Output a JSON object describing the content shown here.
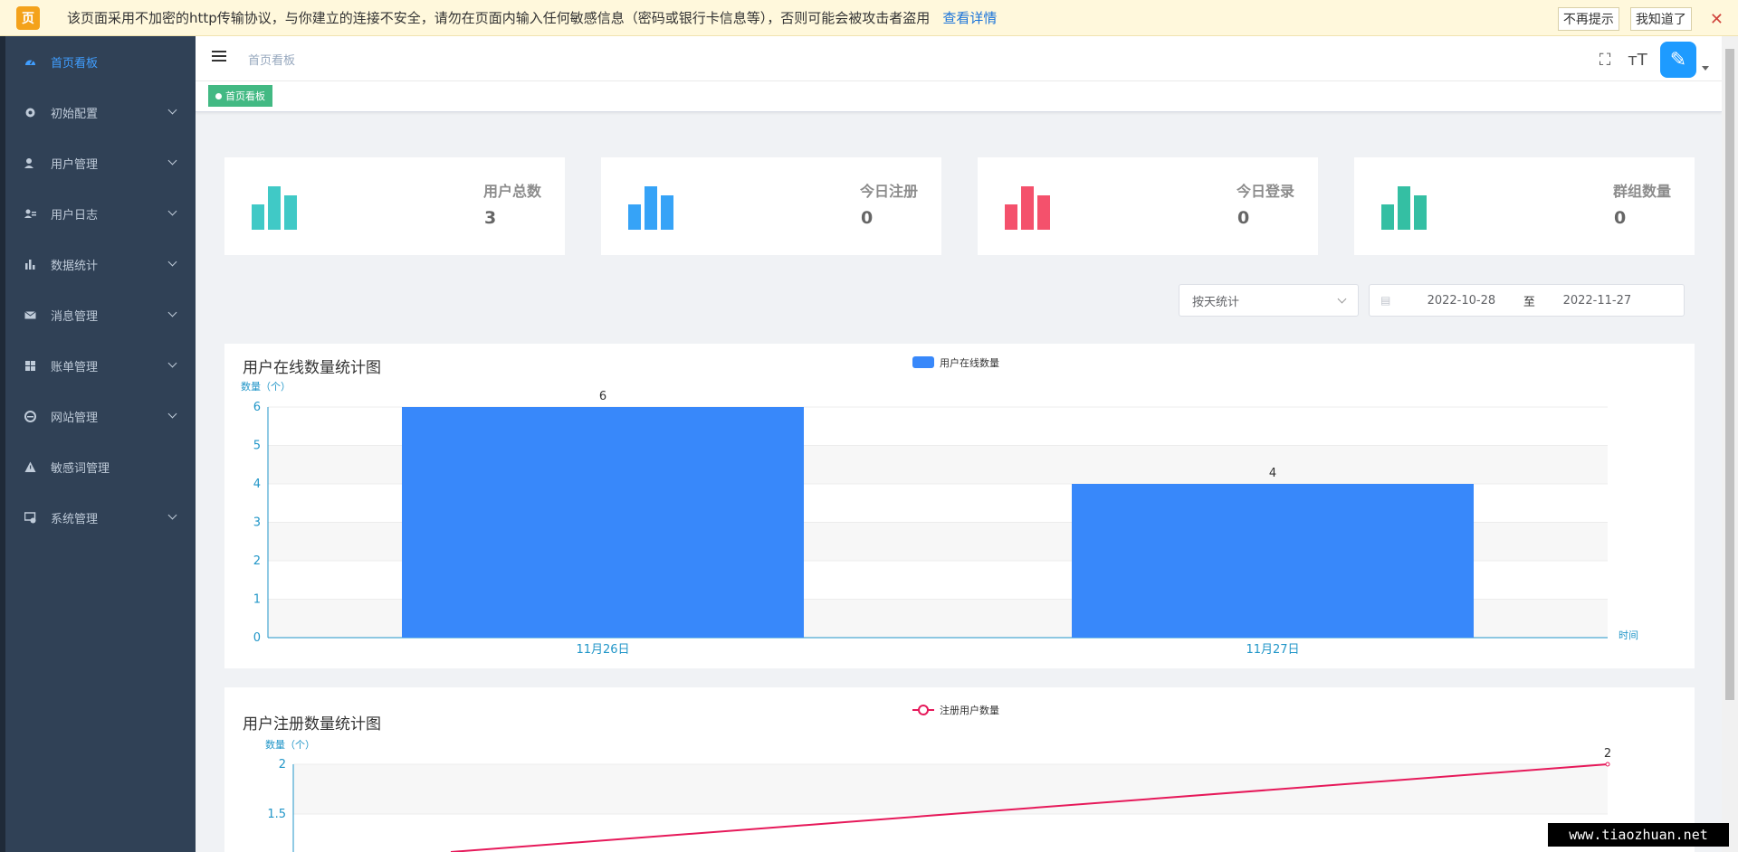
{
  "banner": {
    "logo": "页",
    "text": "该页面采用不加密的http传输协议，与你建立的连接不安全，请勿在页面内输入任何敏感信息（密码或银行卡信息等），否则可能会被攻击者盗用",
    "link": "查看详情",
    "no_remind": "不再提示",
    "got_it": "我知道了",
    "close": "✕"
  },
  "sidebar": {
    "items": [
      {
        "label": "首页看板",
        "icon": "dashboard-icon",
        "active": true
      },
      {
        "label": "初始配置",
        "icon": "settings-gear-icon",
        "expandable": true
      },
      {
        "label": "用户管理",
        "icon": "user-icon",
        "expandable": true
      },
      {
        "label": "用户日志",
        "icon": "user-log-icon",
        "expandable": true
      },
      {
        "label": "数据统计",
        "icon": "bar-chart-icon",
        "expandable": true
      },
      {
        "label": "消息管理",
        "icon": "mail-icon",
        "expandable": true
      },
      {
        "label": "账单管理",
        "icon": "grid-icon",
        "expandable": true
      },
      {
        "label": "网站管理",
        "icon": "browser-icon",
        "expandable": true
      },
      {
        "label": "敏感词管理",
        "icon": "warning-icon",
        "expandable": false
      },
      {
        "label": "系统管理",
        "icon": "system-icon",
        "expandable": true
      }
    ]
  },
  "navbar": {
    "breadcrumb": "首页看板",
    "fullscreen_icon": "⛶",
    "fontsize_icon": "тT",
    "avatar_glyph": "✎"
  },
  "tags": {
    "active": "首页看板"
  },
  "cards": [
    {
      "label": "用户总数",
      "value": "3",
      "color": "#40c9c6"
    },
    {
      "label": "今日注册",
      "value": "0",
      "color": "#36a3f7"
    },
    {
      "label": "今日登录",
      "value": "0",
      "color": "#f4516c"
    },
    {
      "label": "群组数量",
      "value": "0",
      "color": "#34bfa3"
    }
  ],
  "filters": {
    "mode": "按天统计",
    "start_date": "2022-10-28",
    "separator": "至",
    "end_date": "2022-11-27"
  },
  "chart_data": [
    {
      "type": "bar",
      "title": "用户在线数量统计图",
      "legend": "用户在线数量",
      "ylabel": "数量（个）",
      "xlabel": "时间",
      "categories": [
        "11月26日",
        "11月27日"
      ],
      "values": [
        6,
        4
      ],
      "ylim": [
        0,
        6
      ],
      "yticks": [
        0,
        1,
        2,
        3,
        4,
        5,
        6
      ],
      "color": "#3888fa",
      "legend_position": "top-center"
    },
    {
      "type": "line",
      "title": "用户注册数量统计图",
      "legend": "注册用户数量",
      "ylabel": "数量（个）",
      "yticks_visible": [
        2,
        1.5
      ],
      "last_point_label": "2",
      "ylim": [
        0,
        2
      ],
      "color": "#e6195a",
      "legend_position": "top-center"
    }
  ],
  "watermark": "www.tiaozhuan.net"
}
